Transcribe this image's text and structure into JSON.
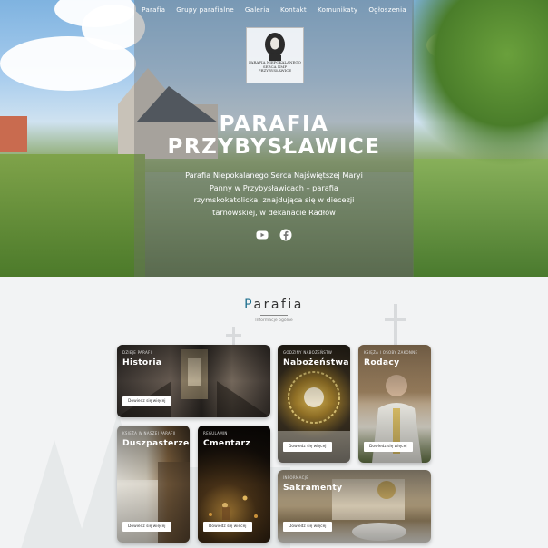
{
  "nav": {
    "items": [
      "Parafia",
      "Grupy parafialne",
      "Galeria",
      "Kontakt",
      "Komunikaty",
      "Ogłoszenia"
    ]
  },
  "logo": {
    "line1": "PARAFIA NIEPOKALANEGO",
    "line2": "SERCA NMP",
    "line3": "PRZYBYSŁAWICE"
  },
  "hero": {
    "title_line1": "PARAFIA",
    "title_line2": "PRZYBYSŁAWICE",
    "description": "Parafia Niepokalanego Serca Najświętszej Maryi Panny w Przybysławicach – parafia rzymskokatolicka, znajdująca się w diecezji tarnowskiej, w dekanacie Radłów",
    "social": [
      {
        "icon": "youtube-icon"
      },
      {
        "icon": "facebook-icon"
      }
    ]
  },
  "section": {
    "heading_first": "P",
    "heading_rest": "arafia",
    "subheading": "Informacje ogólne"
  },
  "cards": [
    {
      "sub": "DZIEJE PARAFII",
      "title": "Historia",
      "button": "Dowiedz się więcej"
    },
    {
      "sub": "GODZINY NABOŻEŃSTW",
      "title": "Nabożeństwa",
      "button": "Dowiedz się więcej"
    },
    {
      "sub": "KSIĘŻA I OSOBY ZAKONNE",
      "title": "Rodacy",
      "button": "Dowiedz się więcej"
    },
    {
      "sub": "KSIĘŻA W NASZEJ PARAFII",
      "title": "Duszpasterze",
      "button": "Dowiedz się więcej"
    },
    {
      "sub": "REGULAMIN",
      "title": "Cmentarz",
      "button": "Dowiedz się więcej"
    },
    {
      "sub": "INFORMACJE",
      "title": "Sakramenty",
      "button": "Dowiedz się więcej"
    }
  ],
  "colors": {
    "accent": "#1e6f8e",
    "overlay": "#6e6e6e"
  }
}
